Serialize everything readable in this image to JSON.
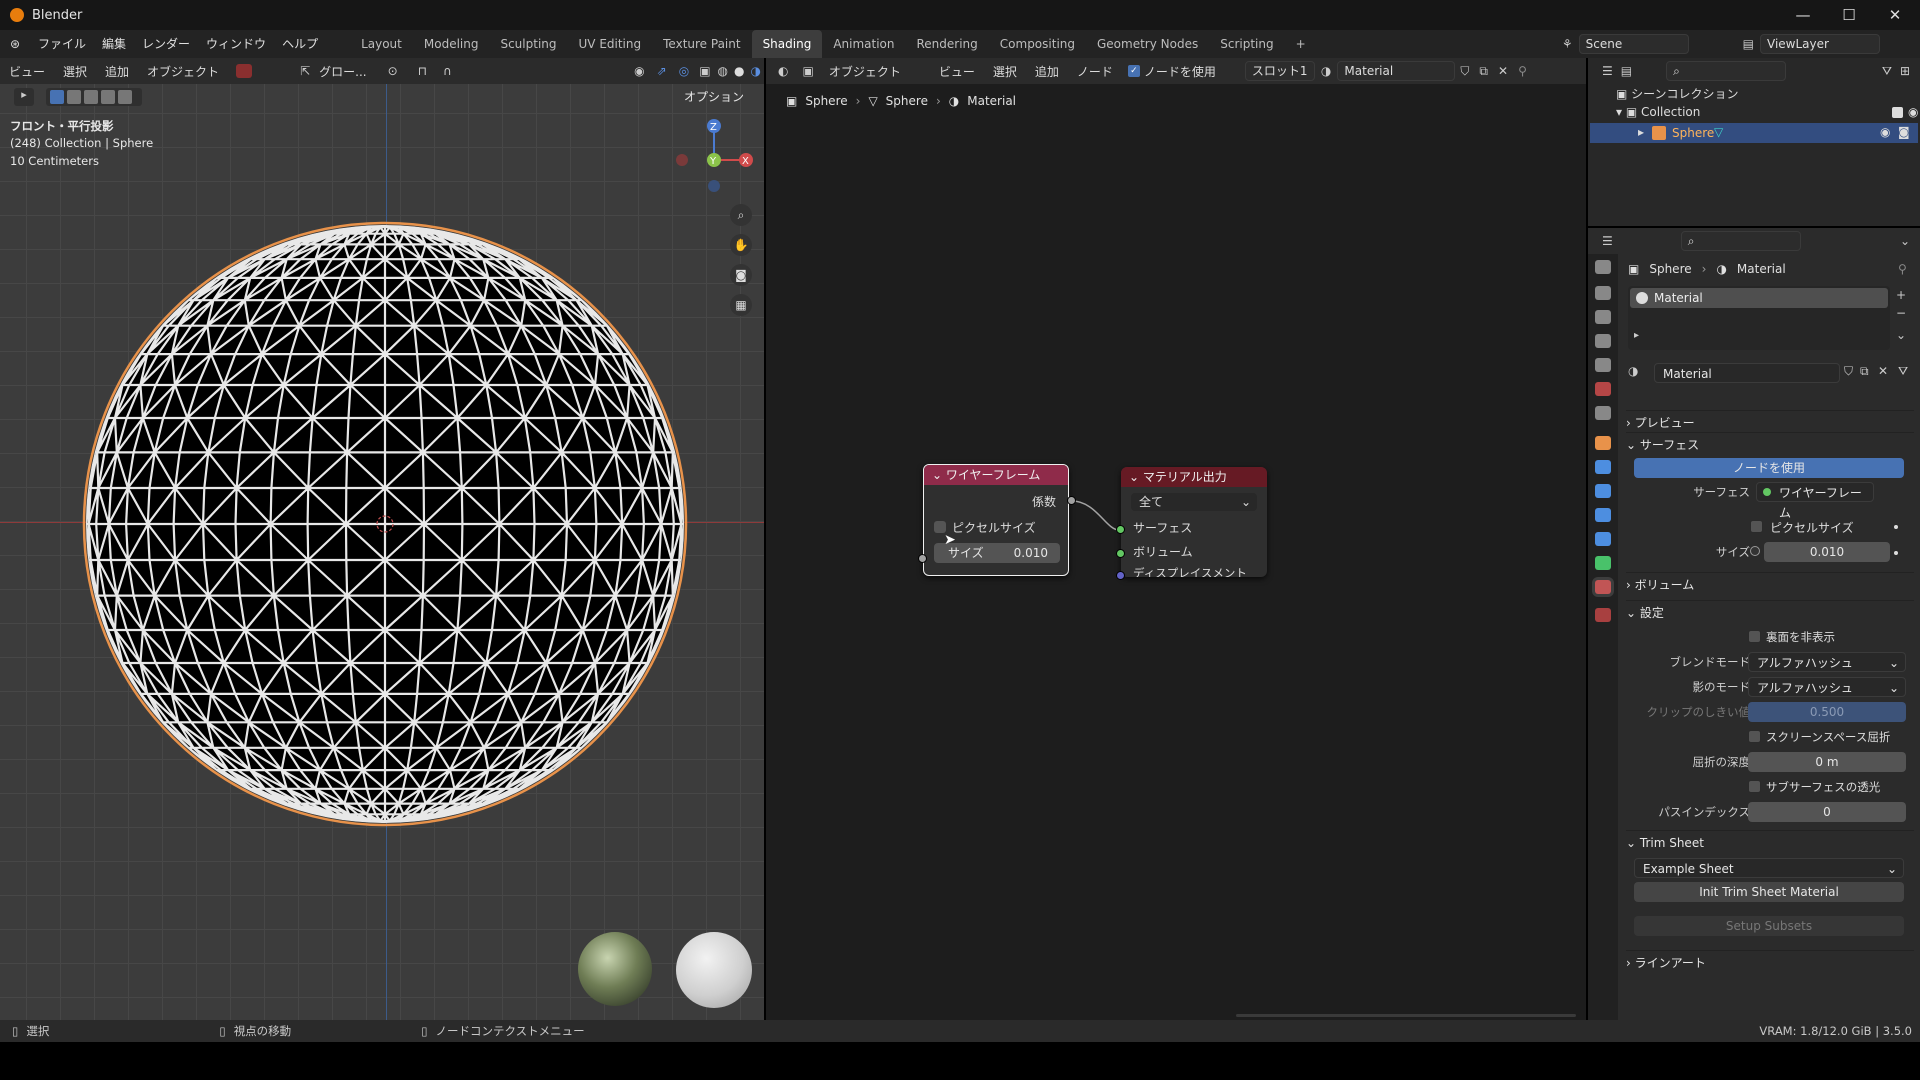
{
  "window": {
    "title": "Blender",
    "minimize": "—",
    "maximize": "☐",
    "close": "✕"
  },
  "menubar": {
    "items": [
      "ファイル",
      "編集",
      "レンダー",
      "ウィンドウ",
      "ヘルプ"
    ]
  },
  "workspaces": {
    "tabs": [
      "Layout",
      "Modeling",
      "Sculpting",
      "UV Editing",
      "Texture Paint",
      "Shading",
      "Animation",
      "Rendering",
      "Compositing",
      "Geometry Nodes",
      "Scripting"
    ],
    "active": "Shading",
    "add": "+"
  },
  "scene": {
    "name": "Scene",
    "view_layer": "ViewLayer"
  },
  "viewport": {
    "menu": [
      "ビュー",
      "選択",
      "追加",
      "オブジェクト"
    ],
    "orientation": "グロー...",
    "options": "オプション",
    "view_name": "フロント・平行投影",
    "collection_info": "(248) Collection | Sphere",
    "scale": "10 Centimeters",
    "gizmo": {
      "z": "Z",
      "y": "Y",
      "x": "X"
    }
  },
  "node_editor": {
    "mode": "オブジェクト",
    "menu": [
      "ビュー",
      "選択",
      "追加",
      "ノード"
    ],
    "use_nodes": "ノードを使用",
    "slot": "スロット1",
    "material": "Material",
    "breadcrumb": [
      "Sphere",
      "Sphere",
      "Material"
    ],
    "wireframe_node": {
      "title": "ワイヤーフレーム",
      "output": "係数",
      "pixel_size": "ピクセルサイズ",
      "size_label": "サイズ",
      "size_value": "0.010"
    },
    "output_node": {
      "title": "マテリアル出力",
      "target": "全て",
      "inputs": [
        "サーフェス",
        "ボリューム",
        "ディスプレイスメント"
      ]
    }
  },
  "outliner": {
    "root": "シーンコレクション",
    "collection": "Collection",
    "object": "Sphere"
  },
  "properties": {
    "breadcrumb": [
      "Sphere",
      "Material"
    ],
    "slot_item": "Material",
    "material_name": "Material",
    "sections": {
      "preview": "プレビュー",
      "surface": "サーフェス",
      "volume": "ボリューム",
      "settings": "設定",
      "trim_sheet": "Trim Sheet",
      "line_art": "ラインアート"
    },
    "use_nodes_button": "ノードを使用",
    "surface_label": "サーフェス",
    "surface_value": "ワイヤーフレーム",
    "pixel_size": "ピクセルサイズ",
    "size_label": "サイズ",
    "size_value": "0.010",
    "backface_culling": "裏面を非表示",
    "blend_mode_label": "ブレンドモード",
    "blend_mode": "アルファハッシュ",
    "shadow_mode_label": "影のモード",
    "shadow_mode": "アルファハッシュ",
    "clip_label": "クリップのしきい値",
    "clip_value": "0.500",
    "ssr": "スクリーンスペース屈折",
    "refraction_depth_label": "屈折の深度",
    "refraction_depth": "0 m",
    "sss_translucency": "サブサーフェスの透光",
    "pass_index_label": "パスインデックス",
    "pass_index": "0",
    "trim_sheet_select": "Example Sheet",
    "init_button": "Init Trim Sheet Material",
    "setup_button": "Setup Subsets"
  },
  "statusbar": {
    "select": "選択",
    "move_view": "視点の移動",
    "node_menu": "ノードコンテクストメニュー",
    "vram": "VRAM: 1.8/12.0 GiB | 3.5.0"
  },
  "colors": {
    "accent": "#4772b3",
    "wire_header": "#8f2b4a",
    "output_header": "#661a24",
    "selection_orange": "#e8924a",
    "socket_green": "#63c763",
    "socket_purple": "#6363c7",
    "socket_gray": "#a1a1a1"
  }
}
